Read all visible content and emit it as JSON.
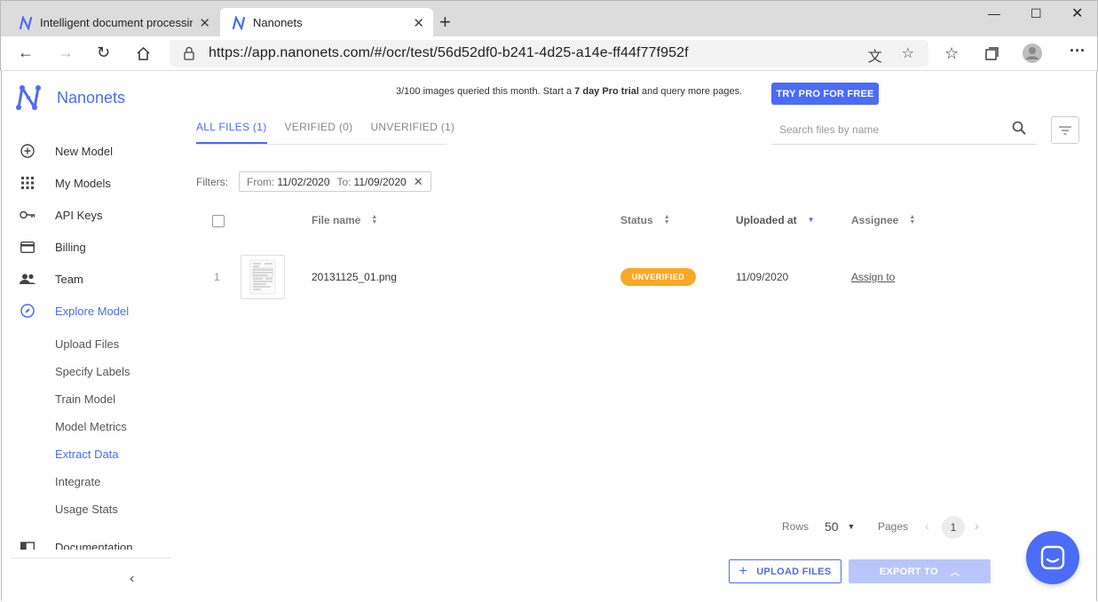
{
  "browser": {
    "tabs": [
      {
        "title": "Intelligent document processing",
        "active": false
      },
      {
        "title": "Nanonets",
        "active": true
      }
    ],
    "url": "https://app.nanonets.com/#/ocr/test/56d52df0-b241-4d25-a14e-ff44f77f952f"
  },
  "brand": {
    "name": "Nanonets",
    "color": "#4a6cf7"
  },
  "sidebar": {
    "items": [
      {
        "label": "New Model",
        "icon": "plus-circle-icon"
      },
      {
        "label": "My Models",
        "icon": "grid-icon"
      },
      {
        "label": "API Keys",
        "icon": "key-icon"
      },
      {
        "label": "Billing",
        "icon": "credit-card-icon"
      },
      {
        "label": "Team",
        "icon": "people-icon"
      },
      {
        "label": "Explore Model",
        "icon": "compass-icon",
        "active": true
      },
      {
        "label": "Documentation",
        "icon": "book-icon"
      }
    ],
    "subitems": [
      {
        "label": "Upload Files"
      },
      {
        "label": "Specify Labels"
      },
      {
        "label": "Train Model"
      },
      {
        "label": "Model Metrics"
      },
      {
        "label": "Extract Data",
        "active": true
      },
      {
        "label": "Integrate"
      },
      {
        "label": "Usage Stats"
      }
    ],
    "collapse_icon": "chevron-left-icon"
  },
  "banner": {
    "text_before": "3/100 images queried this month. Start a ",
    "text_bold": "7 day Pro trial",
    "text_after": " and query more pages.",
    "cta": "TRY PRO FOR FREE"
  },
  "file_tabs": [
    {
      "label": "ALL FILES (1)",
      "active": true
    },
    {
      "label": "VERIFIED (0)"
    },
    {
      "label": "UNVERIFIED (1)"
    }
  ],
  "search": {
    "placeholder": "Search files by name",
    "value": ""
  },
  "filters": {
    "label": "Filters:",
    "from_label": "From:",
    "from_value": "11/02/2020",
    "to_label": "To:",
    "to_value": "11/09/2020"
  },
  "table": {
    "columns": [
      "File name",
      "Status",
      "Uploaded at",
      "Assignee"
    ],
    "rows": [
      {
        "index": "1",
        "file_name": "20131125_01.png",
        "status": "UNVERIFIED",
        "uploaded_at": "11/09/2020",
        "assignee": "Assign to"
      }
    ]
  },
  "pagination": {
    "rows_label": "Rows",
    "rows_value": "50",
    "pages_label": "Pages",
    "current_page": "1"
  },
  "actions": {
    "upload": "UPLOAD FILES",
    "export": "EXPORT TO"
  },
  "colors": {
    "accent": "#4a6cf7",
    "status_unverified": "#f9a825",
    "export_disabled": "#b9c6fb"
  }
}
